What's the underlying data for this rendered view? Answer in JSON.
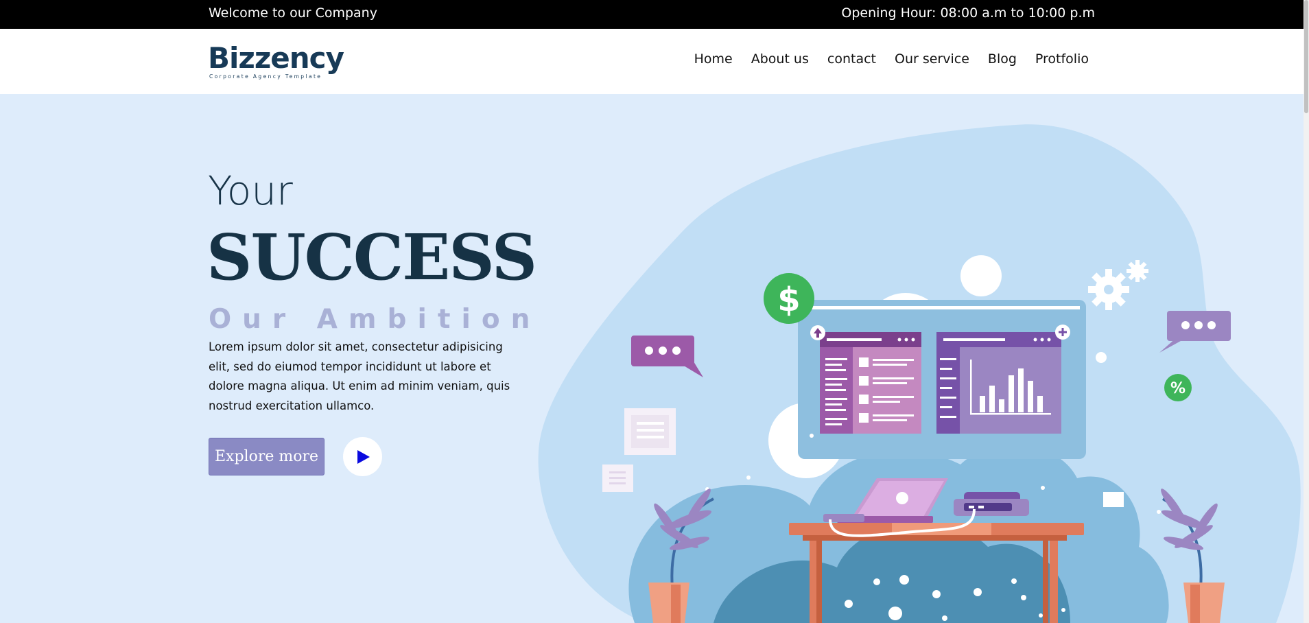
{
  "topbar": {
    "welcome": "Welcome to our Company",
    "hours": "Opening Hour: 08:00 a.m to 10:00 p.m"
  },
  "logo": {
    "text": "Bizzency",
    "tagline": "Corporate Agency Template"
  },
  "nav": [
    "Home",
    "About us",
    "contact",
    "Our service",
    "Blog",
    "Protfolio"
  ],
  "hero": {
    "line1": "Your",
    "line2": "SUCCESS",
    "line3": "Our Ambition",
    "description": "Lorem ipsum dolor sit amet, consectetur adipisicing elit, sed do eiumod tempor incididunt ut labore et dolore magna aliqua. Ut enim ad minim veniam, quis nostrud exercitation ullamco.",
    "explore_label": "Explore more"
  },
  "illustration": {
    "dollar_symbol": "$",
    "percent_symbol": "%"
  },
  "colors": {
    "topbar": "#000000",
    "hero_bg": "#deecfb",
    "heading": "#163245",
    "ambition": "#a9b1d6",
    "button": "#8a8ac4",
    "green": "#3eb55a",
    "purple": "#9c5aa8",
    "monitor": "#8ebfdf",
    "desk": "#e07b5c"
  },
  "icons": {
    "play": "play-icon",
    "dollar": "dollar-icon",
    "gear": "gear-icon",
    "chat": "chat-bubble-icon",
    "percent": "percent-icon",
    "laptop": "laptop-icon",
    "plant": "plant-icon"
  }
}
